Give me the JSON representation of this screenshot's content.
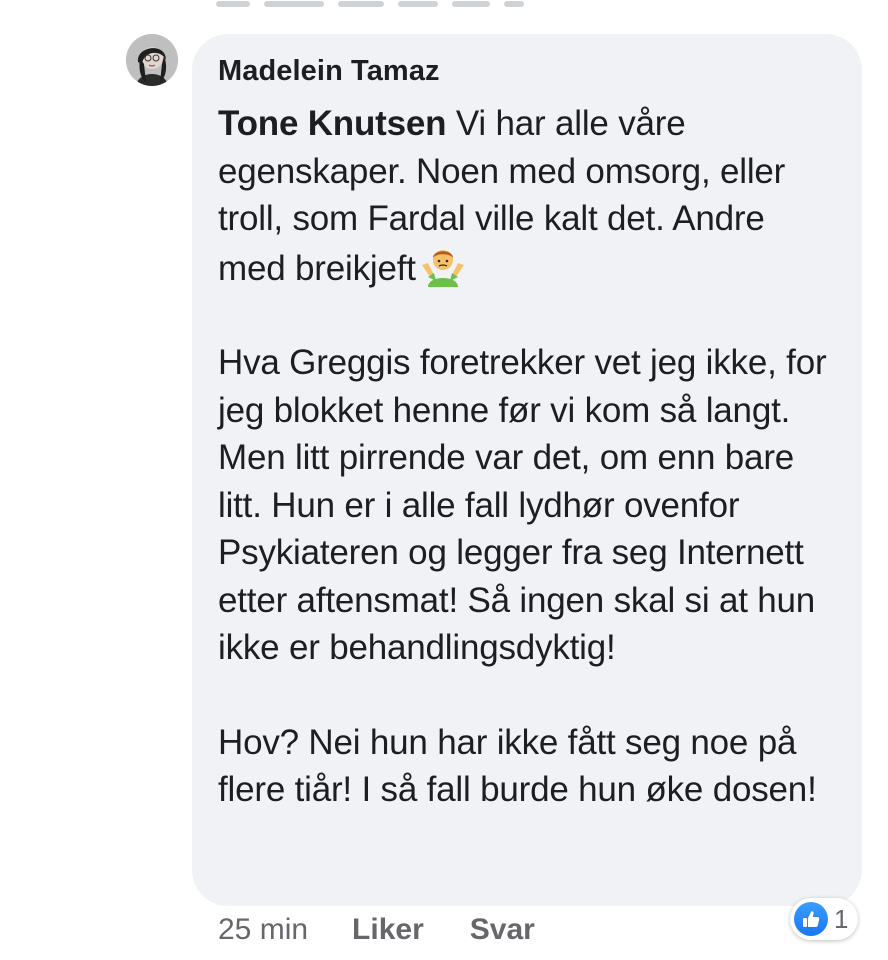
{
  "comment": {
    "author": "Madelein Tamaz",
    "mention": "Tone Knutsen",
    "paragraphs": [
      " Vi har alle våre egenskaper. Noen med omsorg, eller troll, som Fardal ville kalt det. Andre med breikjeft",
      "Hva Greggis foretrekker vet jeg ikke, for jeg blokket henne før vi kom så langt. Men litt pirrende var det, om enn bare litt. Hun er i alle fall lydhør ovenfor Psykiateren og legger fra seg Internett etter aftensmat! Så ingen skal si at hun ikke er behandlingsdyktig!",
      "Hov? Nei hun har ikke fått seg noe på flere tiår! I så fall burde hun øke dosen!"
    ],
    "emoji": "person-shrugging-emoji"
  },
  "meta": {
    "time": "25 min",
    "like_label": "Liker",
    "reply_label": "Svar"
  },
  "reactions": {
    "icon": "thumbs-up-icon",
    "count": "1",
    "color": "#1877f2"
  },
  "colors": {
    "bubble": "#f0f2f5",
    "text": "#1c1e21",
    "meta": "#65676b"
  }
}
